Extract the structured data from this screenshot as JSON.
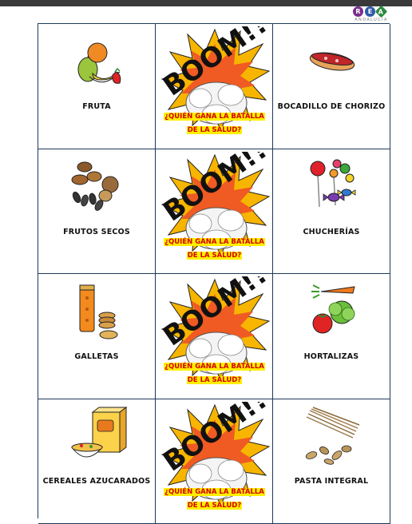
{
  "logo": {
    "letters": [
      "R",
      "E",
      "A"
    ],
    "subtitle": "ANDALUCÍA"
  },
  "boom": {
    "word": "BOOM!!",
    "caption_line1": "¿QUIÉN GANA LA BATALLA",
    "caption_line2": "DE LA SALUD?"
  },
  "cards": {
    "left": [
      "FRUTA",
      "FRUTOS SECOS",
      "GALLETAS",
      "CEREALES AZUCARADOS"
    ],
    "right": [
      "BOCADILLO DE CHORIZO",
      "CHUCHERÍAS",
      "HORTALIZAS",
      "PASTA INTEGRAL"
    ]
  },
  "icons": [
    "fruit-icon",
    "nuts-icon",
    "cookies-icon",
    "cereal-icon",
    "sandwich-icon",
    "candy-icon",
    "vegetables-icon",
    "pasta-icon"
  ]
}
